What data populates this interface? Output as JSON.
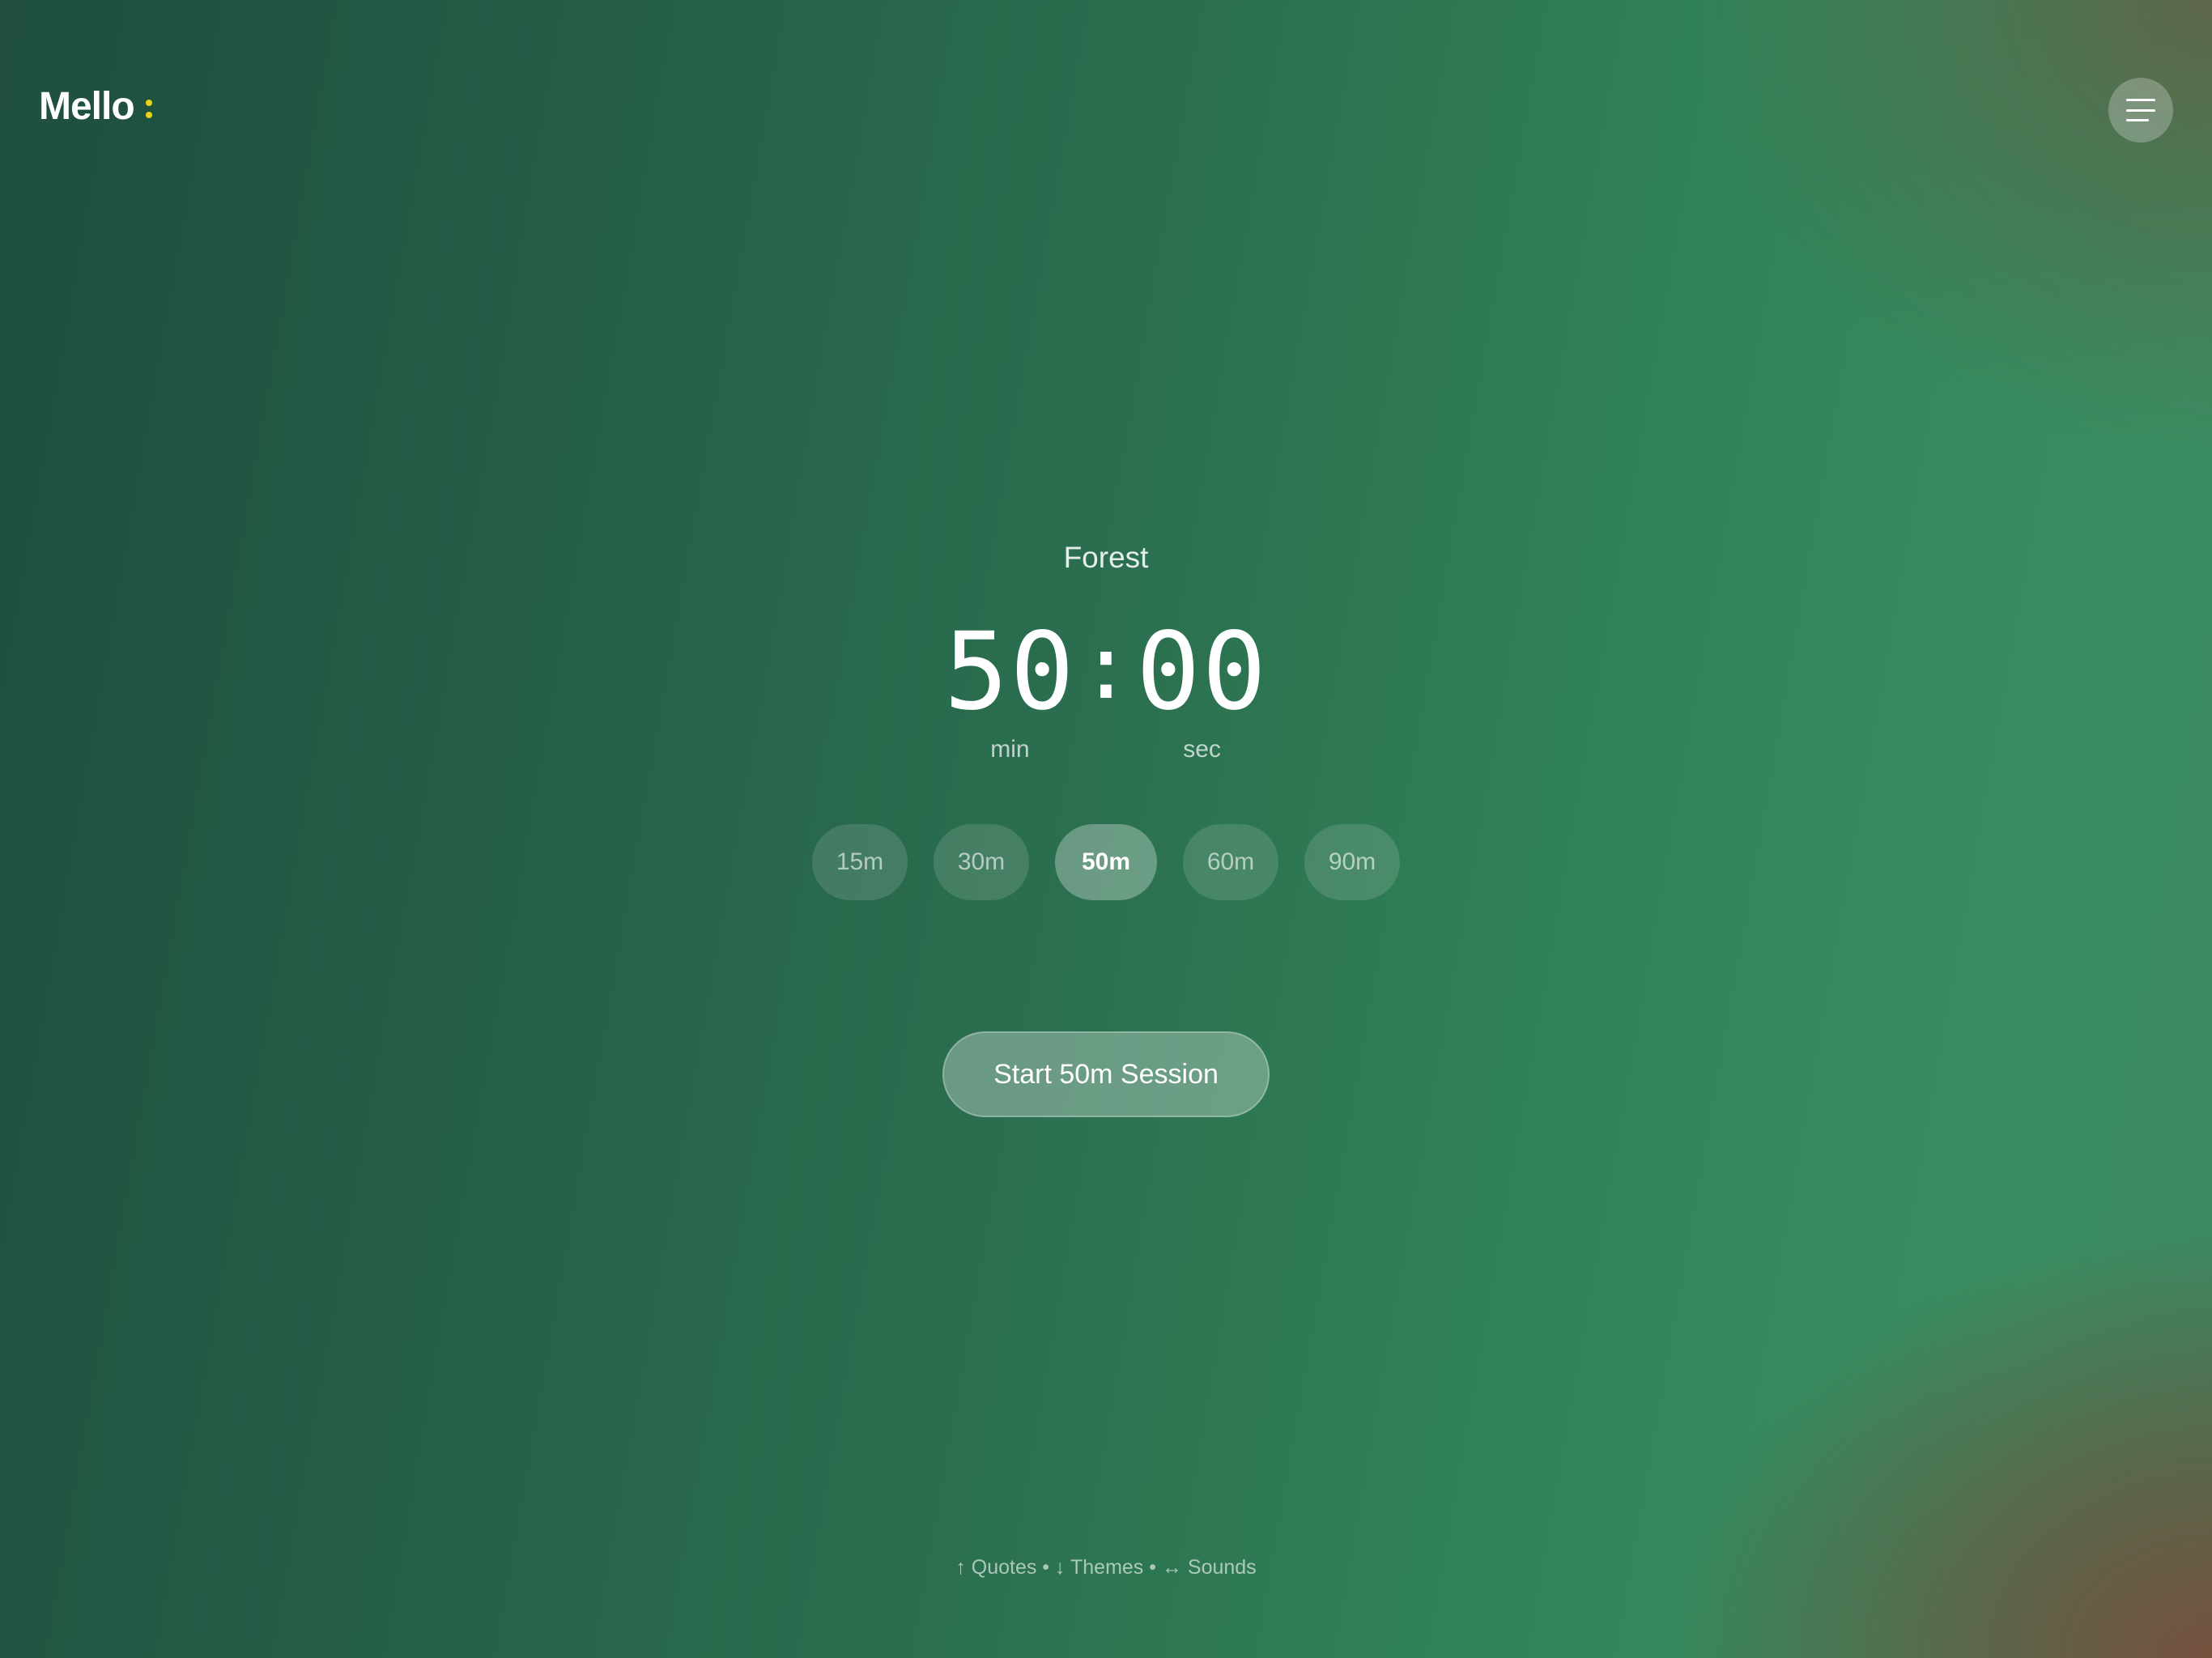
{
  "app": {
    "name": "Mello",
    "accent_color": "#e8d21c"
  },
  "header": {
    "menu_icon": "hamburger-menu-icon"
  },
  "main": {
    "theme_name": "Forest",
    "timer": {
      "minutes": "50",
      "separator": ":",
      "seconds": "00",
      "minutes_unit": "min",
      "seconds_unit": "sec"
    },
    "durations": [
      {
        "label": "15m",
        "selected": false
      },
      {
        "label": "30m",
        "selected": false
      },
      {
        "label": "50m",
        "selected": true
      },
      {
        "label": "60m",
        "selected": false
      },
      {
        "label": "90m",
        "selected": false
      }
    ],
    "start_label": "Start 50m Session"
  },
  "footer": {
    "hints": "↑ Quotes • ↓ Themes • ↔ Sounds"
  }
}
